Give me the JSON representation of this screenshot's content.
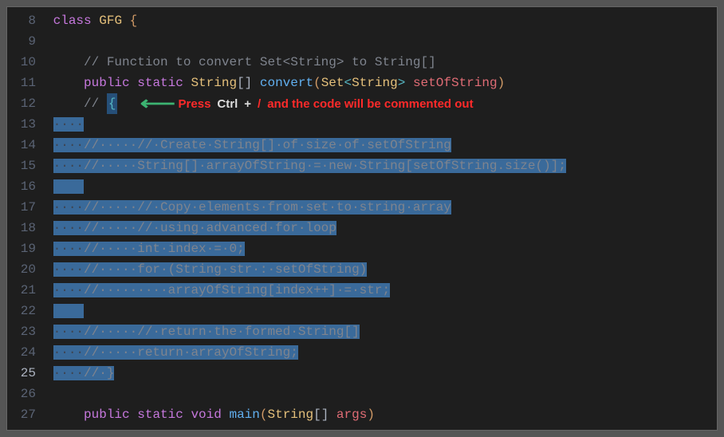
{
  "gutter": {
    "start": 8,
    "end": 27,
    "active": 25
  },
  "annotation": {
    "press": "Press",
    "key1": "Ctrl",
    "plus": "+",
    "key2": "/",
    "rest": "and the code will be commented out"
  },
  "code": {
    "l8": {
      "kw": "class",
      "cls": "GFG",
      "brace": "{"
    },
    "l10": {
      "c1": "// Function to convert Set<String> to String[]"
    },
    "l11": {
      "pub": "public",
      "stat": "static",
      "ret": "String",
      "arr": "[]",
      "name": "convert",
      "lp": "(",
      "pt": "Set",
      "lt": "<",
      "ptg": "String",
      "gt": ">",
      "pn": "setOfString",
      "rp": ")"
    },
    "l12": {
      "c1": "// ",
      "brace": "{"
    },
    "l13": {
      "ws": "····"
    },
    "l14": {
      "ws1": "····",
      "c": "//·····//·Create·String[]·of·size·of·setOfString"
    },
    "l15": {
      "ws1": "····",
      "c": "//·····String[]·arrayOfString·=·new·String[setOfString.size()];"
    },
    "l16": {
      "ws": "    "
    },
    "l17": {
      "ws1": "····",
      "c": "//·····//·Copy·elements·from·set·to·string·array"
    },
    "l18": {
      "ws1": "····",
      "c": "//·····//·using·advanced·for·loop"
    },
    "l19": {
      "ws1": "····",
      "c": "//·····int·index·=·0;"
    },
    "l20": {
      "ws1": "····",
      "c": "//·····for·(String·str·:·setOfString)"
    },
    "l21": {
      "ws1": "····",
      "c": "//·········arrayOfString[index++]·=·str;"
    },
    "l22": {
      "ws": "    "
    },
    "l23": {
      "ws1": "····",
      "c": "//·····//·return·the·formed·String[]"
    },
    "l24": {
      "ws1": "····",
      "c": "//·····return·arrayOfString;"
    },
    "l25": {
      "ws1": "····",
      "c": "//·}"
    },
    "l27": {
      "pub": "public",
      "stat": "static",
      "ret": "void",
      "name": "main",
      "lp": "(",
      "pt": "String",
      "arr": "[]",
      "pn": "args",
      "rp": ")"
    }
  }
}
